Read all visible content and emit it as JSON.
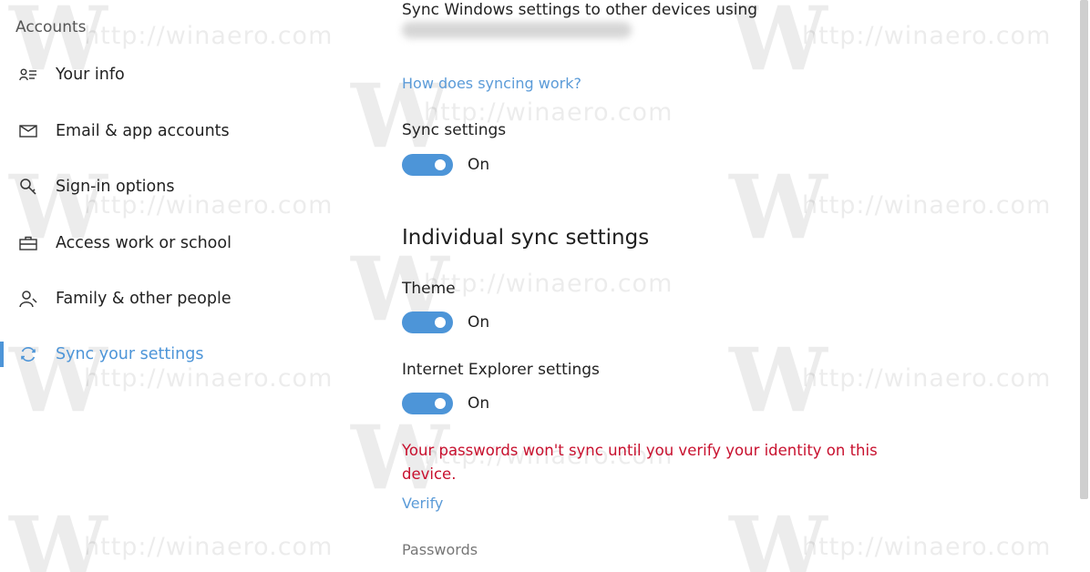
{
  "sidebar": {
    "title": "Accounts",
    "items": [
      {
        "label": "Your info",
        "icon": "person-card-icon"
      },
      {
        "label": "Email & app accounts",
        "icon": "envelope-icon"
      },
      {
        "label": "Sign-in options",
        "icon": "key-icon"
      },
      {
        "label": "Access work or school",
        "icon": "briefcase-icon"
      },
      {
        "label": "Family & other people",
        "icon": "person-add-icon"
      },
      {
        "label": "Sync your settings",
        "icon": "sync-icon",
        "active": true
      }
    ]
  },
  "main": {
    "intro": "Sync Windows settings to other devices using",
    "how_link": "How does syncing work?",
    "sync_settings": {
      "label": "Sync settings",
      "state": "On"
    },
    "individual_title": "Individual sync settings",
    "theme": {
      "label": "Theme",
      "state": "On"
    },
    "ie": {
      "label": "Internet Explorer settings",
      "state": "On"
    },
    "warning": "Your passwords won't sync until you verify your identity on this device.",
    "verify_link": "Verify",
    "passwords_label": "Passwords"
  },
  "watermark": {
    "letter": "W",
    "url": "http://winaero.com"
  },
  "colors": {
    "accent": "#4d95d8",
    "warning": "#c8102e",
    "link": "#5b9bd8"
  }
}
